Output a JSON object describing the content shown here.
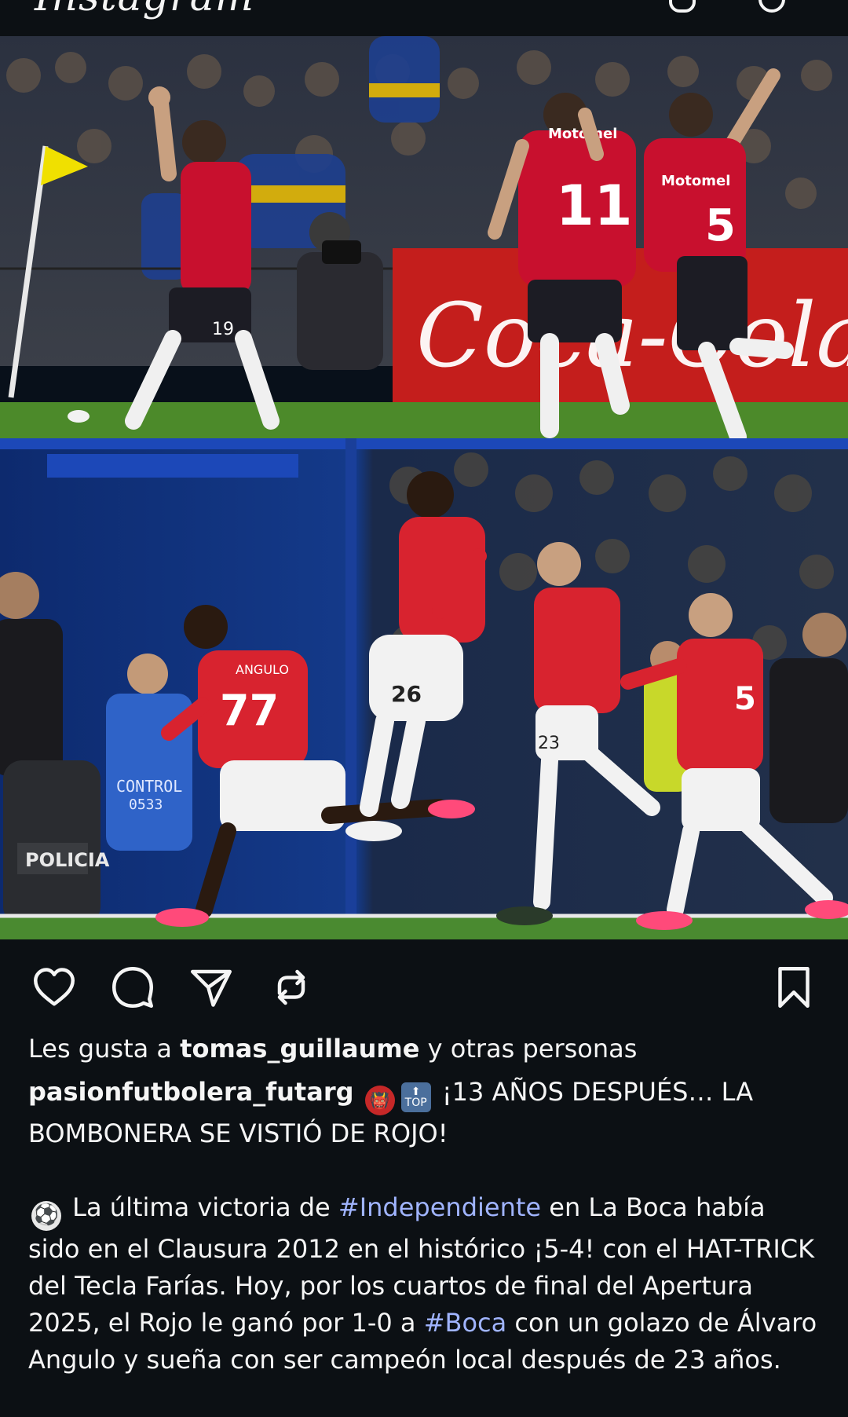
{
  "app": {
    "logo_text": "Instagram"
  },
  "top_icons": [
    "heart-icon",
    "messenger-icon"
  ],
  "media": {
    "photo_top": {
      "banner_text": "Coca-Cola",
      "shirt_sponsor": "Motomel",
      "numbers": [
        "19",
        "11",
        "5"
      ],
      "colors": {
        "shirt": "#c8102e",
        "shorts": "#1c1c24",
        "pitch": "#4c8a2a",
        "banner": "#c41e1c"
      }
    },
    "photo_bottom": {
      "numbers": [
        "77",
        "26",
        "23",
        "5"
      ],
      "player_name": "ANGULO",
      "steward_vest_text": "CONTROL",
      "steward_vest_number": "0533",
      "shield_text": "POLICIA",
      "colors": {
        "shirt": "#d8232f",
        "shorts": "#f2f2f2",
        "background": "#0f2a66"
      }
    }
  },
  "actions": {
    "like": "heart-icon",
    "comment": "comment-icon",
    "share": "send-icon",
    "repost": "repost-icon",
    "save": "bookmark-icon"
  },
  "likes": {
    "prefix": "Les gusta a",
    "user": "tomas_guillaume",
    "suffix": "y otras personas"
  },
  "caption": {
    "username": "pasionfutbolera_futarg",
    "emoji_1": "👹",
    "emoji_2": "🔝",
    "headline": "¡13 AÑOS DESPUÉS… LA BOMBONERA SE VISTIÓ DE ROJO!",
    "emoji_ball": "⚽",
    "body_1": "La última victoria de",
    "hashtag_1": "#Independiente",
    "body_2": "en La Boca había sido en el Clausura 2012 en el histórico ¡5-4! con el HAT-TRICK del Tecla Farías. Hoy, por los cuartos de final del Apertura 2025, el Rojo le ganó por 1-0 a",
    "hashtag_2": "#Boca",
    "body_3": "con un golazo de Álvaro Angulo y sueña con ser campeón local después de 23 años."
  },
  "colors": {
    "background": "#0c1014",
    "text": "#f5f5f5",
    "hashtag": "#a0b4ff"
  }
}
